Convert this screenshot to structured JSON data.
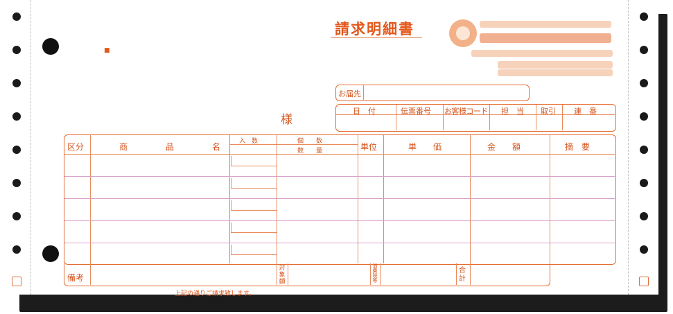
{
  "document": {
    "title": "請求明細書",
    "mark": "■",
    "sama": "様",
    "footer_note": "上記の通りご請求致します。"
  },
  "header_box": {
    "otodokesaki": "お届先",
    "columns": [
      "日　付",
      "伝票番号",
      "お客様コード",
      "担　当",
      "取引",
      "連　番"
    ]
  },
  "main_table": {
    "kubun": "区分",
    "shohinmei": [
      "商",
      "品",
      "名"
    ],
    "irisu": "入　数",
    "kosu": "個　　数",
    "suryo": "数　　量",
    "tani": "単位",
    "tanka": "単　　価",
    "kingaku": "金　　額",
    "tekiyo": "摘　要",
    "biko": "備考",
    "taishogaku": [
      "対",
      "象",
      "額"
    ],
    "shohizei": [
      "消",
      "費",
      "税",
      "等"
    ],
    "gokei": [
      "合",
      "計"
    ]
  },
  "colors": {
    "accent": "#e4571b",
    "rule": "#e88a5b",
    "row_rule": "#d9a0c8"
  }
}
